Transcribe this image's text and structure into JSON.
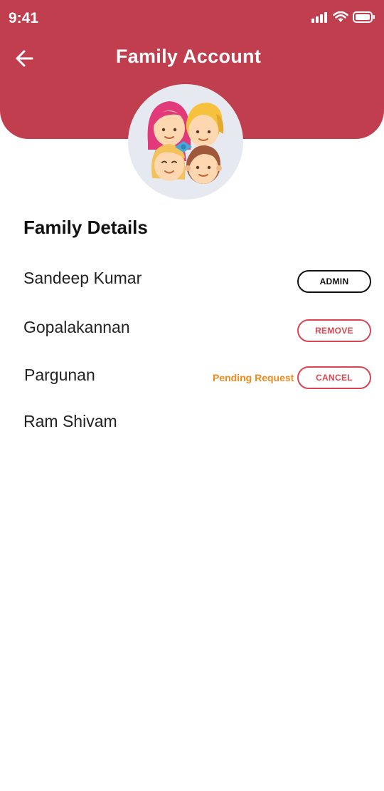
{
  "status_bar": {
    "time": "9:41"
  },
  "header": {
    "title": "Family Account",
    "back_icon": "arrow-left-icon",
    "accent_color": "#c03e4e"
  },
  "avatar": {
    "icon": "family-group-illustration"
  },
  "family": {
    "section_title": "Family Details",
    "members": [
      {
        "name": "Sandeep Kumar",
        "action_label": "ADMIN"
      },
      {
        "name": "Gopalakannan",
        "action_label": "REMOVE"
      },
      {
        "name": "Pargunan",
        "status": "Pending Request",
        "action_label": "CANCEL"
      },
      {
        "name": "Ram Shivam"
      }
    ]
  },
  "colors": {
    "action_red": "#d94552",
    "pending_orange": "#f08a1c"
  }
}
